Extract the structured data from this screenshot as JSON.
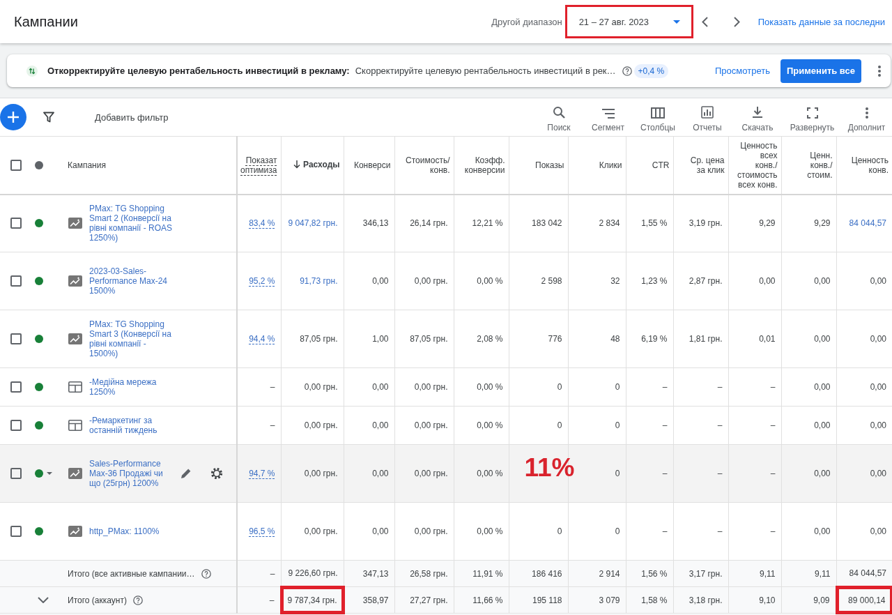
{
  "header": {
    "title": "Кампании",
    "range_label": "Другой диапазон",
    "date_range": {
      "value": "21 – 27 авг. 2023",
      "highlighted": true
    },
    "show_data_link": "Показать данные за последни"
  },
  "recommendation": {
    "title": "Откорректируйте целевую рентабельность инвестиций в рекламу:",
    "description": "Скорректируйте целевую рентабельность инвестиций в рек…",
    "uplift": "+0,4 %",
    "view_link": "Просмотреть",
    "apply_button": "Применить все"
  },
  "toolbar": {
    "add_filter": "Добавить фильтр",
    "actions": [
      {
        "kind": "search",
        "label": "Поиск"
      },
      {
        "kind": "segment",
        "label": "Сегмент"
      },
      {
        "kind": "columns",
        "label": "Столбцы"
      },
      {
        "kind": "reports",
        "label": "Отчеты"
      },
      {
        "kind": "download",
        "label": "Скачать"
      },
      {
        "kind": "expand",
        "label": "Развернуть"
      },
      {
        "kind": "more",
        "label": "Дополнит"
      }
    ]
  },
  "table": {
    "header_checkbox": {
      "checked": false
    },
    "campaign_column": "Кампания",
    "columns": [
      {
        "label": "Показат\nоптимиза",
        "kind": "score",
        "sorted": false
      },
      {
        "label": "Расходы",
        "kind": "metric",
        "sorted": true
      },
      {
        "label": "Конверси",
        "kind": "metric",
        "sorted": false
      },
      {
        "label": "Стоимость/\nконв.",
        "kind": "metric",
        "sorted": false
      },
      {
        "label": "Коэфф.\nконверсии",
        "kind": "metric",
        "sorted": false
      },
      {
        "label": "Показы",
        "kind": "metric",
        "sorted": false
      },
      {
        "label": "Клики",
        "kind": "metric",
        "sorted": false
      },
      {
        "label": "CTR",
        "kind": "metric",
        "sorted": false
      },
      {
        "label": "Ср. цена\nза клик",
        "kind": "metric",
        "sorted": false
      },
      {
        "label": "Ценность\nвсех\nконв./\nстоимость\nвсех конв.",
        "kind": "metric",
        "sorted": false
      },
      {
        "label": "Ценн.\nконв./\nстоим.",
        "kind": "metric",
        "sorted": false
      },
      {
        "label": "Ценность\nконв.",
        "kind": "metric",
        "sorted": false
      }
    ],
    "rows": [
      {
        "selected": false,
        "color": "#188038",
        "kind": "pmax",
        "hovered": false,
        "name": "PMax: TG Shopping Smart 2 (Конверсії на рівні компанії - ROAS 1250%)",
        "cells": [
          {
            "text": "83,4 %",
            "link": true
          },
          {
            "text": "9 047,82 грн.",
            "link": true
          },
          {
            "text": "346,13",
            "link": false
          },
          {
            "text": "26,14 грн.",
            "link": false
          },
          {
            "text": "12,21 %",
            "link": false
          },
          {
            "text": "183 042",
            "link": false
          },
          {
            "text": "2 834",
            "link": false
          },
          {
            "text": "1,55 %",
            "link": false
          },
          {
            "text": "3,19 грн.",
            "link": false
          },
          {
            "text": "9,29",
            "link": false
          },
          {
            "text": "9,29",
            "link": false
          },
          {
            "text": "84 044,57",
            "link": true
          }
        ]
      },
      {
        "selected": false,
        "color": "#188038",
        "kind": "pmax",
        "hovered": false,
        "name": "2023-03-Sales-Performance Max-24 1500%",
        "cells": [
          {
            "text": "95,2 %",
            "link": true
          },
          {
            "text": "91,73 грн.",
            "link": true
          },
          {
            "text": "0,00",
            "link": false
          },
          {
            "text": "0,00 грн.",
            "link": false
          },
          {
            "text": "0,00 %",
            "link": false
          },
          {
            "text": "2 598",
            "link": false
          },
          {
            "text": "32",
            "link": false
          },
          {
            "text": "1,23 %",
            "link": false
          },
          {
            "text": "2,87 грн.",
            "link": false
          },
          {
            "text": "0,00",
            "link": false
          },
          {
            "text": "0,00",
            "link": false
          },
          {
            "text": "0,00",
            "link": false
          }
        ]
      },
      {
        "selected": false,
        "color": "#188038",
        "kind": "pmax",
        "hovered": false,
        "name": "PMax: TG Shopping Smart 3 (Конверсії на рівні компанії - 1500%)",
        "cells": [
          {
            "text": "94,4 %",
            "link": true
          },
          {
            "text": "87,05 грн.",
            "link": false
          },
          {
            "text": "1,00",
            "link": false
          },
          {
            "text": "87,05 грн.",
            "link": false
          },
          {
            "text": "2,08 %",
            "link": false
          },
          {
            "text": "776",
            "link": false
          },
          {
            "text": "48",
            "link": false
          },
          {
            "text": "6,19 %",
            "link": false
          },
          {
            "text": "1,81 грн.",
            "link": false
          },
          {
            "text": "0,01",
            "link": false
          },
          {
            "text": "0,00",
            "link": false
          },
          {
            "text": "0,00",
            "link": false
          }
        ]
      },
      {
        "selected": false,
        "color": "#188038",
        "kind": "display",
        "hovered": false,
        "name": "-Медійна мережа 1250%",
        "cells": [
          {
            "text": "–",
            "link": false
          },
          {
            "text": "0,00 грн.",
            "link": false
          },
          {
            "text": "0,00",
            "link": false
          },
          {
            "text": "0,00 грн.",
            "link": false
          },
          {
            "text": "0,00 %",
            "link": false
          },
          {
            "text": "0",
            "link": false
          },
          {
            "text": "0",
            "link": false
          },
          {
            "text": "–",
            "link": false
          },
          {
            "text": "–",
            "link": false
          },
          {
            "text": "–",
            "link": false
          },
          {
            "text": "0,00",
            "link": false
          },
          {
            "text": "0,00",
            "link": false
          }
        ]
      },
      {
        "selected": false,
        "color": "#188038",
        "kind": "display",
        "hovered": false,
        "name": "-Ремаркетинг за останній тиждень",
        "cells": [
          {
            "text": "–",
            "link": false
          },
          {
            "text": "0,00 грн.",
            "link": false
          },
          {
            "text": "0,00",
            "link": false
          },
          {
            "text": "0,00 грн.",
            "link": false
          },
          {
            "text": "0,00 %",
            "link": false
          },
          {
            "text": "0",
            "link": false
          },
          {
            "text": "0",
            "link": false
          },
          {
            "text": "–",
            "link": false
          },
          {
            "text": "–",
            "link": false
          },
          {
            "text": "–",
            "link": false
          },
          {
            "text": "0,00",
            "link": false
          },
          {
            "text": "0,00",
            "link": false
          }
        ]
      },
      {
        "selected": false,
        "color": "#188038",
        "kind": "pmax",
        "hovered": true,
        "name": "Sales-Performance Max-36 Продажі чи що (25грн) 1200%",
        "cells": [
          {
            "text": "94,7 %",
            "link": true
          },
          {
            "text": "0,00 грн.",
            "link": false
          },
          {
            "text": "0,00",
            "link": false
          },
          {
            "text": "0,00 грн.",
            "link": false
          },
          {
            "text": "0,00 %",
            "link": false
          },
          {
            "annotation": "11%"
          },
          {
            "text": "0",
            "link": false
          },
          {
            "text": "–",
            "link": false
          },
          {
            "text": "–",
            "link": false
          },
          {
            "text": "–",
            "link": false
          },
          {
            "text": "0,00",
            "link": false
          },
          {
            "text": "0,00",
            "link": false
          }
        ]
      },
      {
        "selected": false,
        "color": "#188038",
        "kind": "pmax",
        "hovered": false,
        "name": "http_PMax: 1100%",
        "cells": [
          {
            "text": "96,5 %",
            "link": true
          },
          {
            "text": "0,00 грн.",
            "link": false
          },
          {
            "text": "0,00",
            "link": false
          },
          {
            "text": "0,00 грн.",
            "link": false
          },
          {
            "text": "0,00 %",
            "link": false
          },
          {
            "text": "0",
            "link": false
          },
          {
            "text": "0",
            "link": false
          },
          {
            "text": "–",
            "link": false
          },
          {
            "text": "–",
            "link": false
          },
          {
            "text": "–",
            "link": false
          },
          {
            "text": "0,00",
            "link": false
          },
          {
            "text": "0,00",
            "link": false
          }
        ]
      }
    ],
    "totals": [
      {
        "kind": "active",
        "label": "Итого (все активные кампании…",
        "cells": [
          {
            "text": "–",
            "highlighted": false
          },
          {
            "text": "9 226,60 грн.",
            "highlighted": false
          },
          {
            "text": "347,13",
            "highlighted": false
          },
          {
            "text": "26,58 грн.",
            "highlighted": false
          },
          {
            "text": "11,91 %",
            "highlighted": false
          },
          {
            "text": "186 416",
            "highlighted": false
          },
          {
            "text": "2 914",
            "highlighted": false
          },
          {
            "text": "1,56 %",
            "highlighted": false
          },
          {
            "text": "3,17 грн.",
            "highlighted": false
          },
          {
            "text": "9,11",
            "highlighted": false
          },
          {
            "text": "9,11",
            "highlighted": false
          },
          {
            "text": "84 044,57",
            "highlighted": false
          }
        ]
      },
      {
        "kind": "account",
        "label": "Итого (аккаунт)",
        "cells": [
          {
            "text": "–",
            "highlighted": false
          },
          {
            "text": "9 787,34 грн.",
            "highlighted": true
          },
          {
            "text": "358,97",
            "highlighted": false
          },
          {
            "text": "27,27 грн.",
            "highlighted": false
          },
          {
            "text": "11,66 %",
            "highlighted": false
          },
          {
            "text": "195 118",
            "highlighted": false
          },
          {
            "text": "3 079",
            "highlighted": false
          },
          {
            "text": "1,58 %",
            "highlighted": false
          },
          {
            "text": "3,18 грн.",
            "highlighted": false
          },
          {
            "text": "9,10",
            "highlighted": false
          },
          {
            "text": "9,09",
            "highlighted": false
          },
          {
            "text": "89 000,14",
            "highlighted": true
          }
        ]
      }
    ]
  }
}
